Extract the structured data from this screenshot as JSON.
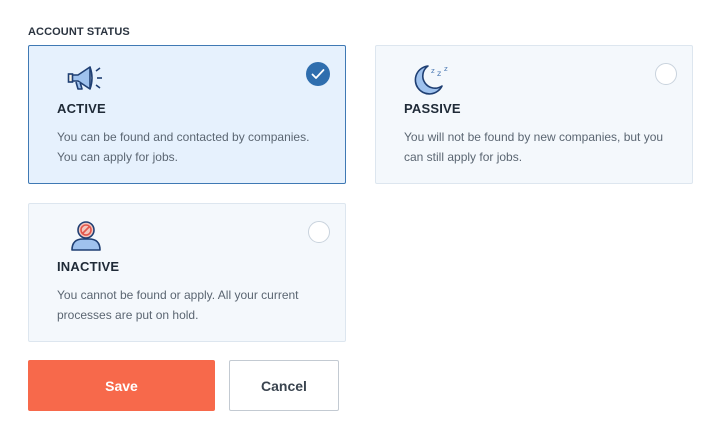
{
  "section": {
    "label": "ACCOUNT STATUS"
  },
  "options": [
    {
      "id": "active",
      "title": "ACTIVE",
      "description": "You can be found and contacted by companies. You can apply for jobs.",
      "icon": "megaphone-icon",
      "selected": true
    },
    {
      "id": "passive",
      "title": "PASSIVE",
      "description": "You will not be found by new companies, but you can still apply for jobs.",
      "icon": "sleeping-moon-icon",
      "selected": false
    },
    {
      "id": "inactive",
      "title": "INACTIVE",
      "description": "You cannot be found or apply. All your current processes are put on hold.",
      "icon": "blocked-user-icon",
      "selected": false
    }
  ],
  "actions": {
    "save_label": "Save",
    "cancel_label": "Cancel"
  },
  "colors": {
    "accent": "#2f6eae",
    "selected_bg": "#e6f1fd",
    "card_bg": "#f4f8fc",
    "save_button": "#f7694b"
  }
}
